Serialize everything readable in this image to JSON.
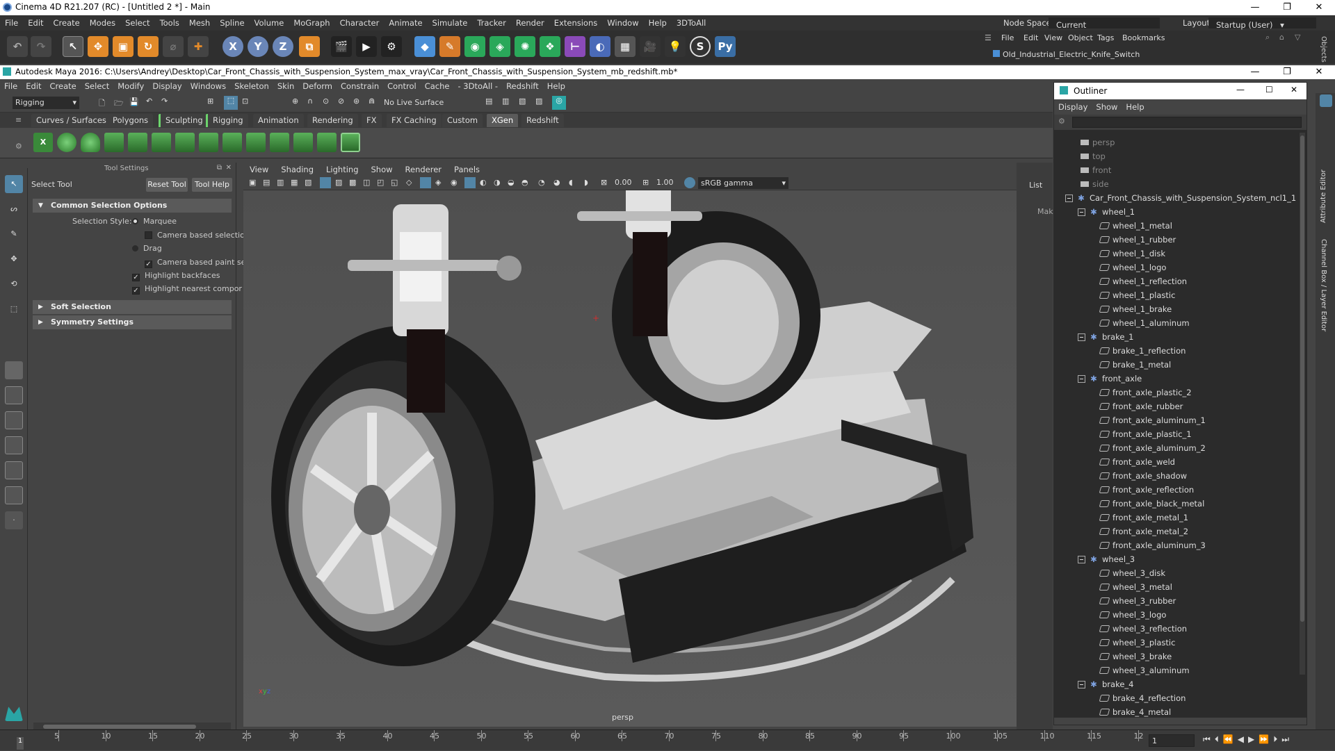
{
  "c4d": {
    "title": "Cinema 4D R21.207 (RC) - [Untitled 2 *] - Main",
    "menu": [
      "File",
      "Edit",
      "Create",
      "Modes",
      "Select",
      "Tools",
      "Mesh",
      "Spline",
      "Volume",
      "MoGraph",
      "Character",
      "Animate",
      "Simulate",
      "Tracker",
      "Render",
      "Extensions",
      "Window",
      "Help",
      "3DToAll"
    ],
    "node_space_label": "Node Space:",
    "node_space_value": "Current (Standard/Physical)",
    "layout_label": "Layout:",
    "layout_value": "Startup (User)",
    "objmgr_menu": [
      "File",
      "Edit",
      "View",
      "Object",
      "Tags",
      "Bookmarks"
    ],
    "objmgr_item": "Old_Industrial_Electric_Knife_Switch",
    "objects_tab": "Objects",
    "axis_x": "X",
    "axis_y": "Y",
    "axis_z": "Z"
  },
  "maya": {
    "title": "Autodesk Maya 2016: C:\\Users\\Andrey\\Desktop\\Car_Front_Chassis_with_Suspension_System_max_vray\\Car_Front_Chassis_with_Suspension_System_mb_redshift.mb*",
    "menu": [
      "File",
      "Edit",
      "Create",
      "Select",
      "Modify",
      "Display",
      "Windows",
      "Skeleton",
      "Skin",
      "Deform",
      "Constrain",
      "Control",
      "Cache",
      "- 3DtoAll -",
      "Redshift",
      "Help"
    ],
    "mode": "Rigging",
    "live_surface": "No Live Surface",
    "shelf_tabs": [
      "Curves / Surfaces",
      "Polygons",
      "Sculpting",
      "Rigging",
      "Animation",
      "Rendering",
      "FX",
      "FX Caching",
      "Custom",
      "XGen",
      "Redshift"
    ],
    "active_shelf": "XGen"
  },
  "toolsettings": {
    "header": "Tool Settings",
    "tool_name": "Select Tool",
    "reset_btn": "Reset Tool",
    "help_btn": "Tool Help",
    "sec_common": "Common Selection Options",
    "selection_style_label": "Selection Style:",
    "marquee": "Marquee",
    "camera_based_selection": "Camera based selectio",
    "drag": "Drag",
    "camera_based_paint": "Camera based paint se",
    "highlight_backfaces": "Highlight backfaces",
    "highlight_nearest": "Highlight nearest compor",
    "sec_soft": "Soft Selection",
    "sec_symmetry": "Symmetry Settings"
  },
  "viewport": {
    "menu": [
      "View",
      "Shading",
      "Lighting",
      "Show",
      "Renderer",
      "Panels"
    ],
    "exposure": "0.00",
    "gamma": "1.00",
    "color_space": "sRGB gamma",
    "camera": "persp"
  },
  "right_panel": {
    "list": "List",
    "mak": "Mak"
  },
  "outliner": {
    "title": "Outliner",
    "menu": [
      "Display",
      "Show",
      "Help"
    ],
    "rows": [
      {
        "label": "persp",
        "kind": "cam",
        "depth": 0
      },
      {
        "label": "top",
        "kind": "cam",
        "depth": 0
      },
      {
        "label": "front",
        "kind": "cam",
        "depth": 0
      },
      {
        "label": "side",
        "kind": "cam",
        "depth": 0
      },
      {
        "label": "Car_Front_Chassis_with_Suspension_System_ncl1_1",
        "kind": "root",
        "depth": 0
      },
      {
        "label": "wheel_1",
        "kind": "grp",
        "depth": 1
      },
      {
        "label": "wheel_1_metal",
        "kind": "mesh",
        "depth": 2
      },
      {
        "label": "wheel_1_rubber",
        "kind": "mesh",
        "depth": 2
      },
      {
        "label": "wheel_1_disk",
        "kind": "mesh",
        "depth": 2
      },
      {
        "label": "wheel_1_logo",
        "kind": "mesh",
        "depth": 2
      },
      {
        "label": "wheel_1_reflection",
        "kind": "mesh",
        "depth": 2
      },
      {
        "label": "wheel_1_plastic",
        "kind": "mesh",
        "depth": 2
      },
      {
        "label": "wheel_1_brake",
        "kind": "mesh",
        "depth": 2
      },
      {
        "label": "wheel_1_aluminum",
        "kind": "mesh",
        "depth": 2
      },
      {
        "label": "brake_1",
        "kind": "grp",
        "depth": 1
      },
      {
        "label": "brake_1_reflection",
        "kind": "mesh",
        "depth": 2
      },
      {
        "label": "brake_1_metal",
        "kind": "mesh",
        "depth": 2
      },
      {
        "label": "front_axle",
        "kind": "grp",
        "depth": 1
      },
      {
        "label": "front_axle_plastic_2",
        "kind": "mesh",
        "depth": 2
      },
      {
        "label": "front_axle_rubber",
        "kind": "mesh",
        "depth": 2
      },
      {
        "label": "front_axle_aluminum_1",
        "kind": "mesh",
        "depth": 2
      },
      {
        "label": "front_axle_plastic_1",
        "kind": "mesh",
        "depth": 2
      },
      {
        "label": "front_axle_aluminum_2",
        "kind": "mesh",
        "depth": 2
      },
      {
        "label": "front_axle_weld",
        "kind": "mesh",
        "depth": 2
      },
      {
        "label": "front_axle_shadow",
        "kind": "mesh",
        "depth": 2
      },
      {
        "label": "front_axle_reflection",
        "kind": "mesh",
        "depth": 2
      },
      {
        "label": "front_axle_black_metal",
        "kind": "mesh",
        "depth": 2
      },
      {
        "label": "front_axle_metal_1",
        "kind": "mesh",
        "depth": 2
      },
      {
        "label": "front_axle_metal_2",
        "kind": "mesh",
        "depth": 2
      },
      {
        "label": "front_axle_aluminum_3",
        "kind": "mesh",
        "depth": 2
      },
      {
        "label": "wheel_3",
        "kind": "grp",
        "depth": 1
      },
      {
        "label": "wheel_3_disk",
        "kind": "mesh",
        "depth": 2
      },
      {
        "label": "wheel_3_metal",
        "kind": "mesh",
        "depth": 2
      },
      {
        "label": "wheel_3_rubber",
        "kind": "mesh",
        "depth": 2
      },
      {
        "label": "wheel_3_logo",
        "kind": "mesh",
        "depth": 2
      },
      {
        "label": "wheel_3_reflection",
        "kind": "mesh",
        "depth": 2
      },
      {
        "label": "wheel_3_plastic",
        "kind": "mesh",
        "depth": 2
      },
      {
        "label": "wheel_3_brake",
        "kind": "mesh",
        "depth": 2
      },
      {
        "label": "wheel_3_aluminum",
        "kind": "mesh",
        "depth": 2
      },
      {
        "label": "brake_4",
        "kind": "grp",
        "depth": 1
      },
      {
        "label": "brake_4_reflection",
        "kind": "mesh",
        "depth": 2
      },
      {
        "label": "brake_4_metal",
        "kind": "mesh",
        "depth": 2
      }
    ]
  },
  "sidetabs": {
    "attr": "Attribute Editor",
    "channel": "Channel Box / Layer Editor"
  },
  "timeline": {
    "ticks": [
      "5",
      "10",
      "15",
      "20",
      "25",
      "30",
      "35",
      "40",
      "45",
      "50",
      "55",
      "60",
      "65",
      "70",
      "75",
      "80",
      "85",
      "90",
      "95",
      "100",
      "105",
      "110",
      "115",
      "12"
    ],
    "current_frame": "1",
    "frame_field": "1"
  },
  "colors": {
    "accent": "#5285a6",
    "c4d_blue": "#3a6ea5"
  }
}
